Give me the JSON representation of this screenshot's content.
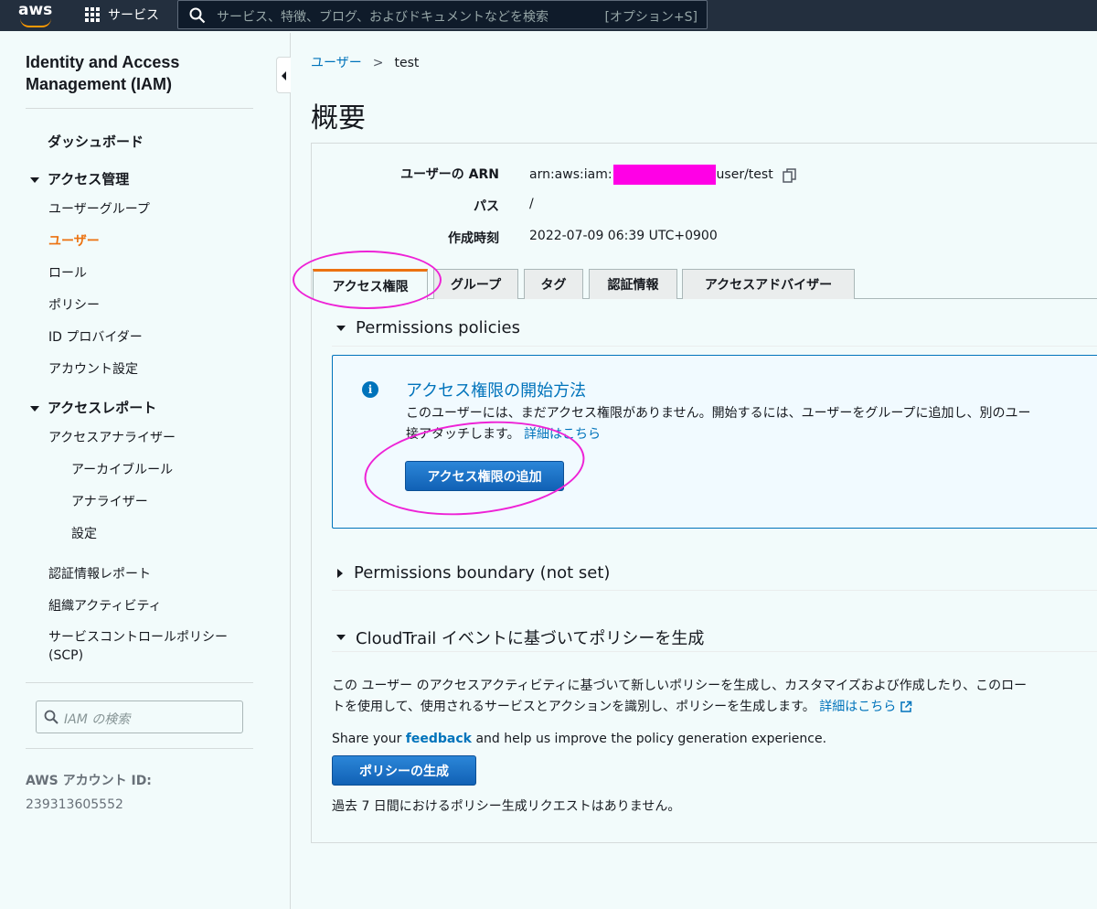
{
  "topnav": {
    "logo_text": "aws",
    "services_label": "サービス",
    "search_placeholder": "サービス、特徴、ブログ、およびドキュメントなどを検索",
    "search_shortcut": "[オプション+S]"
  },
  "sidebar": {
    "title": "Identity and Access Management (IAM)",
    "dashboard": "ダッシュボード",
    "access_management": {
      "label": "アクセス管理",
      "items": [
        "ユーザーグループ",
        "ユーザー",
        "ロール",
        "ポリシー",
        "ID プロバイダー",
        "アカウント設定"
      ]
    },
    "access_reports": {
      "label": "アクセスレポート",
      "analyzer": "アクセスアナライザー",
      "analyzer_items": [
        "アーカイブルール",
        "アナライザー",
        "設定"
      ],
      "items": [
        "認証情報レポート",
        "組織アクティビティ",
        "サービスコントロールポリシー (SCP)"
      ]
    },
    "search_placeholder": "IAM の検索",
    "account_label": "AWS アカウント ID:",
    "account_id": "239313605552",
    "active_item": "ユーザー"
  },
  "breadcrumb": {
    "parent": "ユーザー",
    "separator": ">",
    "current": "test"
  },
  "page_title": "概要",
  "summary": {
    "arn_label": "ユーザーの ARN",
    "arn_prefix": "arn:aws:iam:",
    "arn_suffix": "user/test",
    "path_label": "パス",
    "path_value": "/",
    "created_label": "作成時刻",
    "created_value": "2022-07-09 06:39 UTC+0900"
  },
  "tabs": [
    "アクセス権限",
    "グループ",
    "タグ",
    "認証情報",
    "アクセスアドバイザー"
  ],
  "active_tab": "アクセス権限",
  "permissions_policies": {
    "heading": "Permissions policies",
    "info_title": "アクセス権限の開始方法",
    "info_line1": "このユーザーには、まだアクセス権限がありません。開始するには、ユーザーをグループに追加し、別のユー",
    "info_line2": "接アタッチします。",
    "info_link": "詳細はこちら",
    "add_button": "アクセス権限の追加"
  },
  "permissions_boundary": {
    "heading": "Permissions boundary (not set)"
  },
  "cloudtrail": {
    "heading": "CloudTrail イベントに基づいてポリシーを生成",
    "line1": "この ユーザー のアクセスアクティビティに基づいて新しいポリシーを生成し、カスタマイズおよび作成したり、このロー",
    "line2": "トを使用して、使用されるサービスとアクションを識別し、ポリシーを生成します。",
    "learn_more": "詳細はこちら",
    "feedback_pre": "Share your",
    "feedback_link": "feedback",
    "feedback_post": "and help us improve the policy generation experience.",
    "generate_button": "ポリシーの生成",
    "no_requests": "過去 7 日間におけるポリシー生成リクエストはありません。"
  },
  "colors": {
    "nav_bg": "#232f3e",
    "accent": "#ec7211",
    "link": "#0073bb",
    "redaction": "#ff00e6",
    "annotation": "#ee22d6"
  }
}
